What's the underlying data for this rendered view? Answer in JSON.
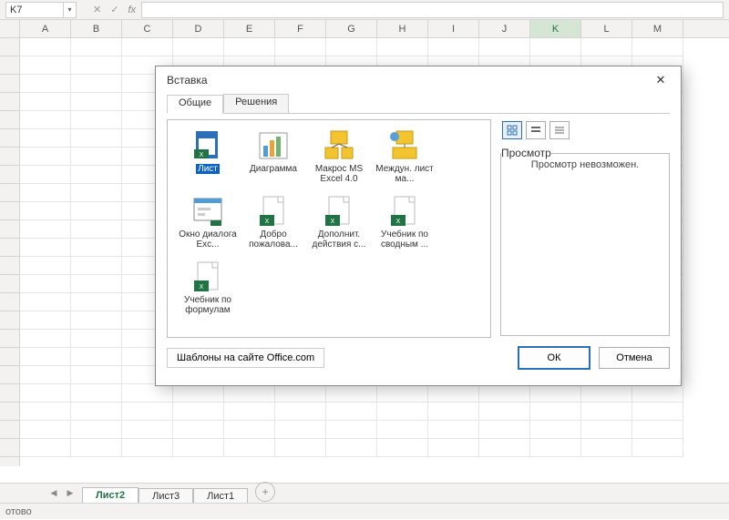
{
  "name_box": "K7",
  "fx_label": "fx",
  "columns": [
    "A",
    "B",
    "C",
    "D",
    "E",
    "F",
    "G",
    "H",
    "I",
    "J",
    "K",
    "L",
    "M"
  ],
  "active_col": "K",
  "sheet_tabs": [
    "Лист2",
    "Лист3",
    "Лист1"
  ],
  "active_sheet": 0,
  "status_text": "отово",
  "dialog": {
    "title": "Вставка",
    "tabs": [
      "Общие",
      "Решения"
    ],
    "active_tab": 0,
    "templates": [
      {
        "label": "Лист",
        "selected": true,
        "icon": "sheet"
      },
      {
        "label": "Диаграмма",
        "icon": "chart"
      },
      {
        "label": "Макрос MS Excel 4.0",
        "icon": "macro"
      },
      {
        "label": "Междун. лист ма...",
        "icon": "intl"
      },
      {
        "label": "Окно диалога Exc...",
        "icon": "dlgwin"
      },
      {
        "label": "Добро пожалова...",
        "icon": "xlsx"
      },
      {
        "label": "Дополнит. действия с...",
        "icon": "xlsx"
      },
      {
        "label": "Учебник по сводным ...",
        "icon": "xlsx"
      },
      {
        "label": "Учебник по формулам",
        "icon": "xlsx"
      }
    ],
    "preview_label": "Просмотр",
    "preview_text": "Просмотр невозможен.",
    "office_link": "Шаблоны на сайте Office.com",
    "ok": "ОК",
    "cancel": "Отмена"
  }
}
